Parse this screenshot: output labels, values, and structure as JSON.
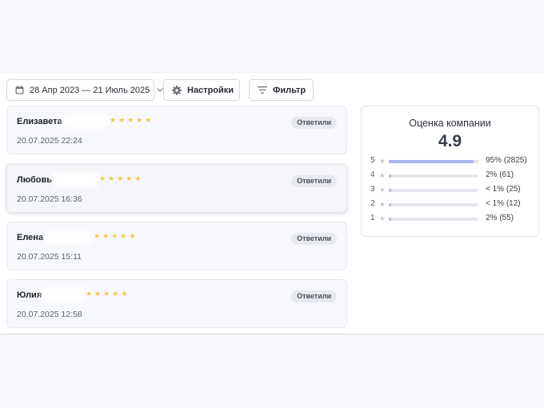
{
  "toolbar": {
    "date_range": "28 Апр 2023 — 21 Июль 2025",
    "settings_label": "Настройки",
    "filter_label": "Фильтр"
  },
  "reviews": [
    {
      "name": "Елизавета",
      "stars": 5,
      "date": "20.07.2025 22:24",
      "status": "Ответили"
    },
    {
      "name": "Любовь",
      "stars": 5,
      "date": "20.07.2025 16:36",
      "status": "Ответили"
    },
    {
      "name": "Елена",
      "stars": 5,
      "date": "20.07.2025 15:11",
      "status": "Ответили"
    },
    {
      "name": "Юлия",
      "stars": 5,
      "date": "20.07.2025 12:58",
      "status": "Ответили"
    }
  ],
  "rating": {
    "title": "Оценка компании",
    "score": "4.9",
    "rows": [
      {
        "level": "5",
        "percent": 95,
        "label": "95% (2825)"
      },
      {
        "level": "4",
        "percent": 2,
        "label": "2% (61)"
      },
      {
        "level": "3",
        "percent": 1,
        "label": "< 1% (25)"
      },
      {
        "level": "2",
        "percent": 0.5,
        "label": "< 1% (12)"
      },
      {
        "level": "1",
        "percent": 2,
        "label": "2% (55)"
      }
    ]
  },
  "colors": {
    "star": "#f2c94c",
    "bar_main": "#a9b4f0",
    "badge_bg": "#e7e9ee"
  }
}
